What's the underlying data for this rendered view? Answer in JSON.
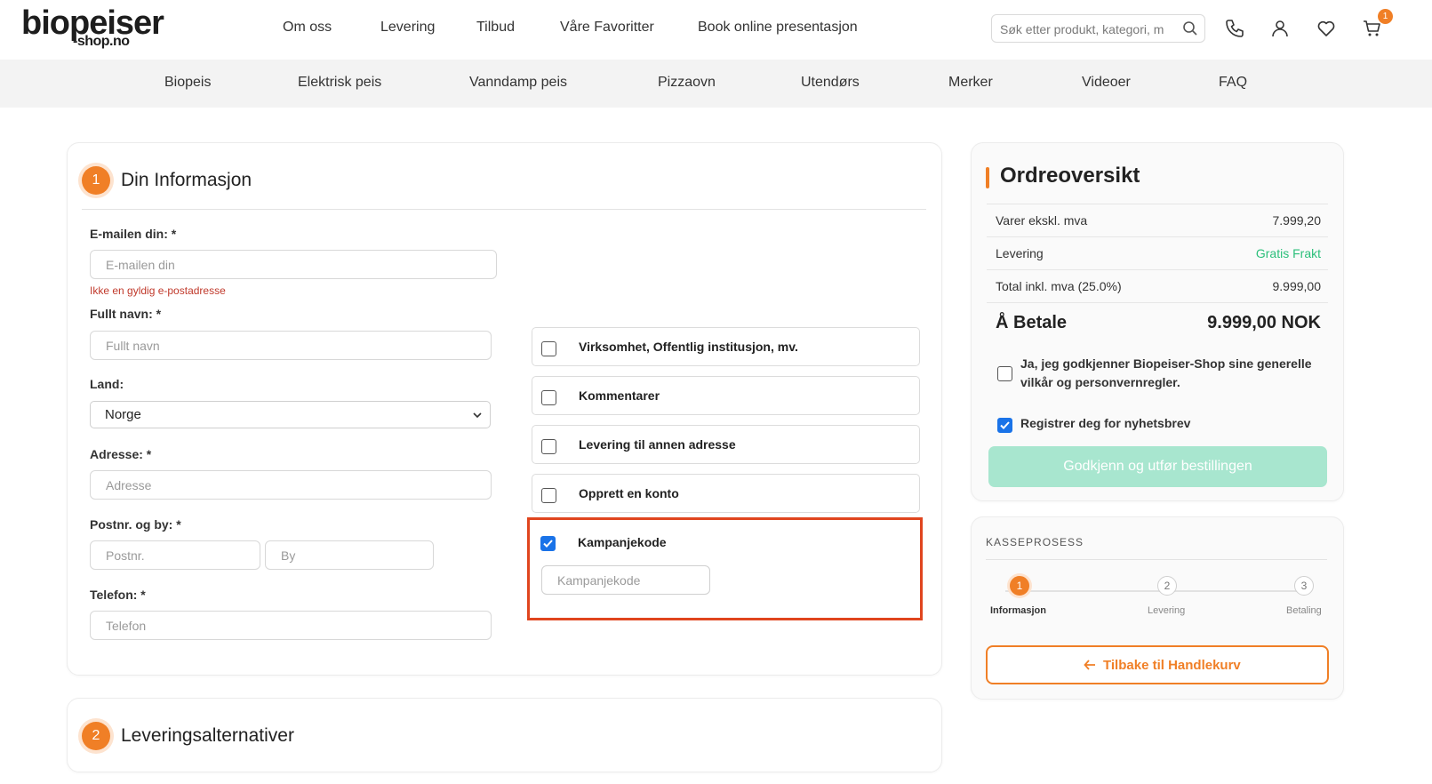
{
  "brand": {
    "logo_main": "biopeiser",
    "logo_sub": "-shop.no",
    "accent": "#f07f26",
    "success": "#2bbf7a"
  },
  "top_nav": [
    "Om oss",
    "Levering",
    "Tilbud",
    "Våre Favoritter",
    "Book online presentasjon"
  ],
  "search": {
    "placeholder": "Søk etter produkt, kategori, m",
    "icon": "search-icon"
  },
  "header_icons": [
    "phone-icon",
    "user-icon",
    "heart-icon",
    "cart-icon"
  ],
  "cart_count": "1",
  "categories": [
    "Biopeis",
    "Elektrisk peis",
    "Vanndamp peis",
    "Pizzaovn",
    "Utendørs",
    "Merker",
    "Videoer",
    "FAQ"
  ],
  "info": {
    "step": "1",
    "title": "Din Informasjon",
    "email_label": "E-mailen din: *",
    "email_placeholder": "E-mailen din",
    "email_error": "Ikke en gyldig e-postadresse",
    "name_label": "Fullt navn: *",
    "name_placeholder": "Fullt navn",
    "country_label": "Land:",
    "country_value": "Norge",
    "address_label": "Adresse: *",
    "address_placeholder": "Adresse",
    "postal_label": "Postnr. og by: *",
    "postal_placeholder": "Postnr.",
    "city_placeholder": "By",
    "phone_label": "Telefon: *",
    "phone_placeholder": "Telefon"
  },
  "options": [
    {
      "label": "Virksomhet, Offentlig institusjon, mv.",
      "checked": false
    },
    {
      "label": "Kommentarer",
      "checked": false
    },
    {
      "label": "Levering til annen adresse",
      "checked": false
    },
    {
      "label": "Opprett en konto",
      "checked": false
    },
    {
      "label": "Kampanjekode",
      "checked": true
    }
  ],
  "campaign_placeholder": "Kampanjekode",
  "delivery": {
    "step": "2",
    "title": "Leveringsalternativer"
  },
  "summary": {
    "title": "Ordreoversikt",
    "rows": [
      {
        "k": "Varer ekskl. mva",
        "v": "7.999,20"
      },
      {
        "k": "Levering",
        "v": "Gratis Frakt"
      },
      {
        "k": "Total inkl. mva (25.0%)",
        "v": "9.999,00"
      }
    ],
    "pay_label": "Å Betale",
    "pay_value": "9.999,00 NOK",
    "terms": "Ja, jeg godkjenner Biopeiser-Shop sine generelle vilkår og personvernregler.",
    "terms_checked": false,
    "newsletter": "Registrer deg for nyhetsbrev",
    "newsletter_checked": true,
    "confirm": "Godkjenn og utfør bestillingen"
  },
  "process": {
    "title": "KASSEPROSESS",
    "steps": [
      {
        "n": "1",
        "label": "Informasjon",
        "active": true
      },
      {
        "n": "2",
        "label": "Levering",
        "active": false
      },
      {
        "n": "3",
        "label": "Betaling",
        "active": false
      }
    ],
    "back": "Tilbake til Handlekurv"
  }
}
